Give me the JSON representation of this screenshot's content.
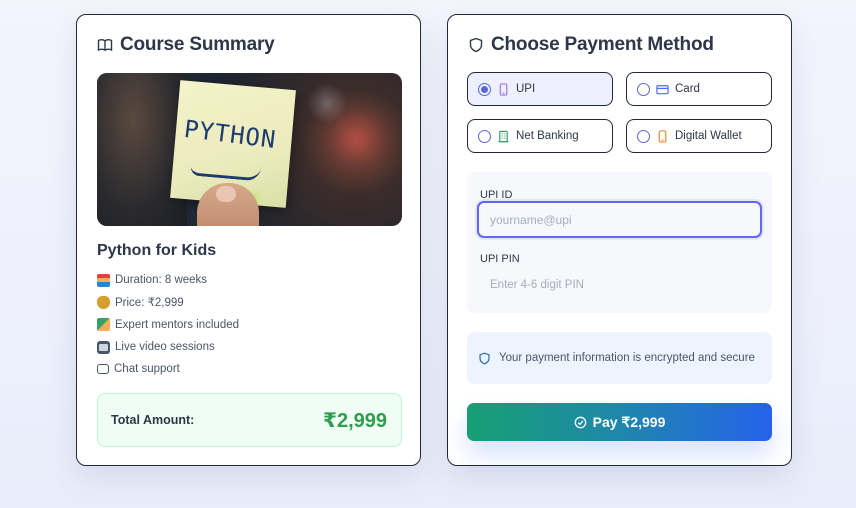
{
  "summary": {
    "title": "Course Summary",
    "image_text": "PYTHON",
    "course_name": "Python for Kids",
    "features": [
      {
        "icon": "books-emoji-icon",
        "text": "Duration: 8 weeks"
      },
      {
        "icon": "money-bag-emoji-icon",
        "text": "Price: ₹2,999"
      },
      {
        "icon": "teacher-emoji-icon",
        "text": "Expert mentors included"
      },
      {
        "icon": "tv-emoji-icon",
        "text": "Live video sessions"
      },
      {
        "icon": "speech-bubble-icon",
        "text": "Chat support"
      }
    ],
    "total_label": "Total Amount:",
    "total_value": "₹2,999",
    "colors": {
      "total_value": "#2f9e4f",
      "total_bg": "#f0fdf4"
    }
  },
  "payment": {
    "title": "Choose Payment Method",
    "methods": [
      {
        "label": "UPI",
        "icon": "phone-icon",
        "selected": true
      },
      {
        "label": "Card",
        "icon": "credit-card-icon",
        "selected": false
      },
      {
        "label": "Net Banking",
        "icon": "bank-icon",
        "selected": false
      },
      {
        "label": "Digital Wallet",
        "icon": "wallet-icon",
        "selected": false
      }
    ],
    "upi_id_label": "UPI ID",
    "upi_id_placeholder": "yourname@upi",
    "upi_id_value": "",
    "upi_pin_label": "UPI PIN",
    "upi_pin_placeholder": "Enter 4-6 digit PIN",
    "secure_text": "Your payment information is encrypted and secure",
    "pay_label": "Pay ₹2,999",
    "colors": {
      "accent": "#6366f1",
      "pay_start": "#16a072",
      "pay_end": "#2563eb"
    }
  }
}
